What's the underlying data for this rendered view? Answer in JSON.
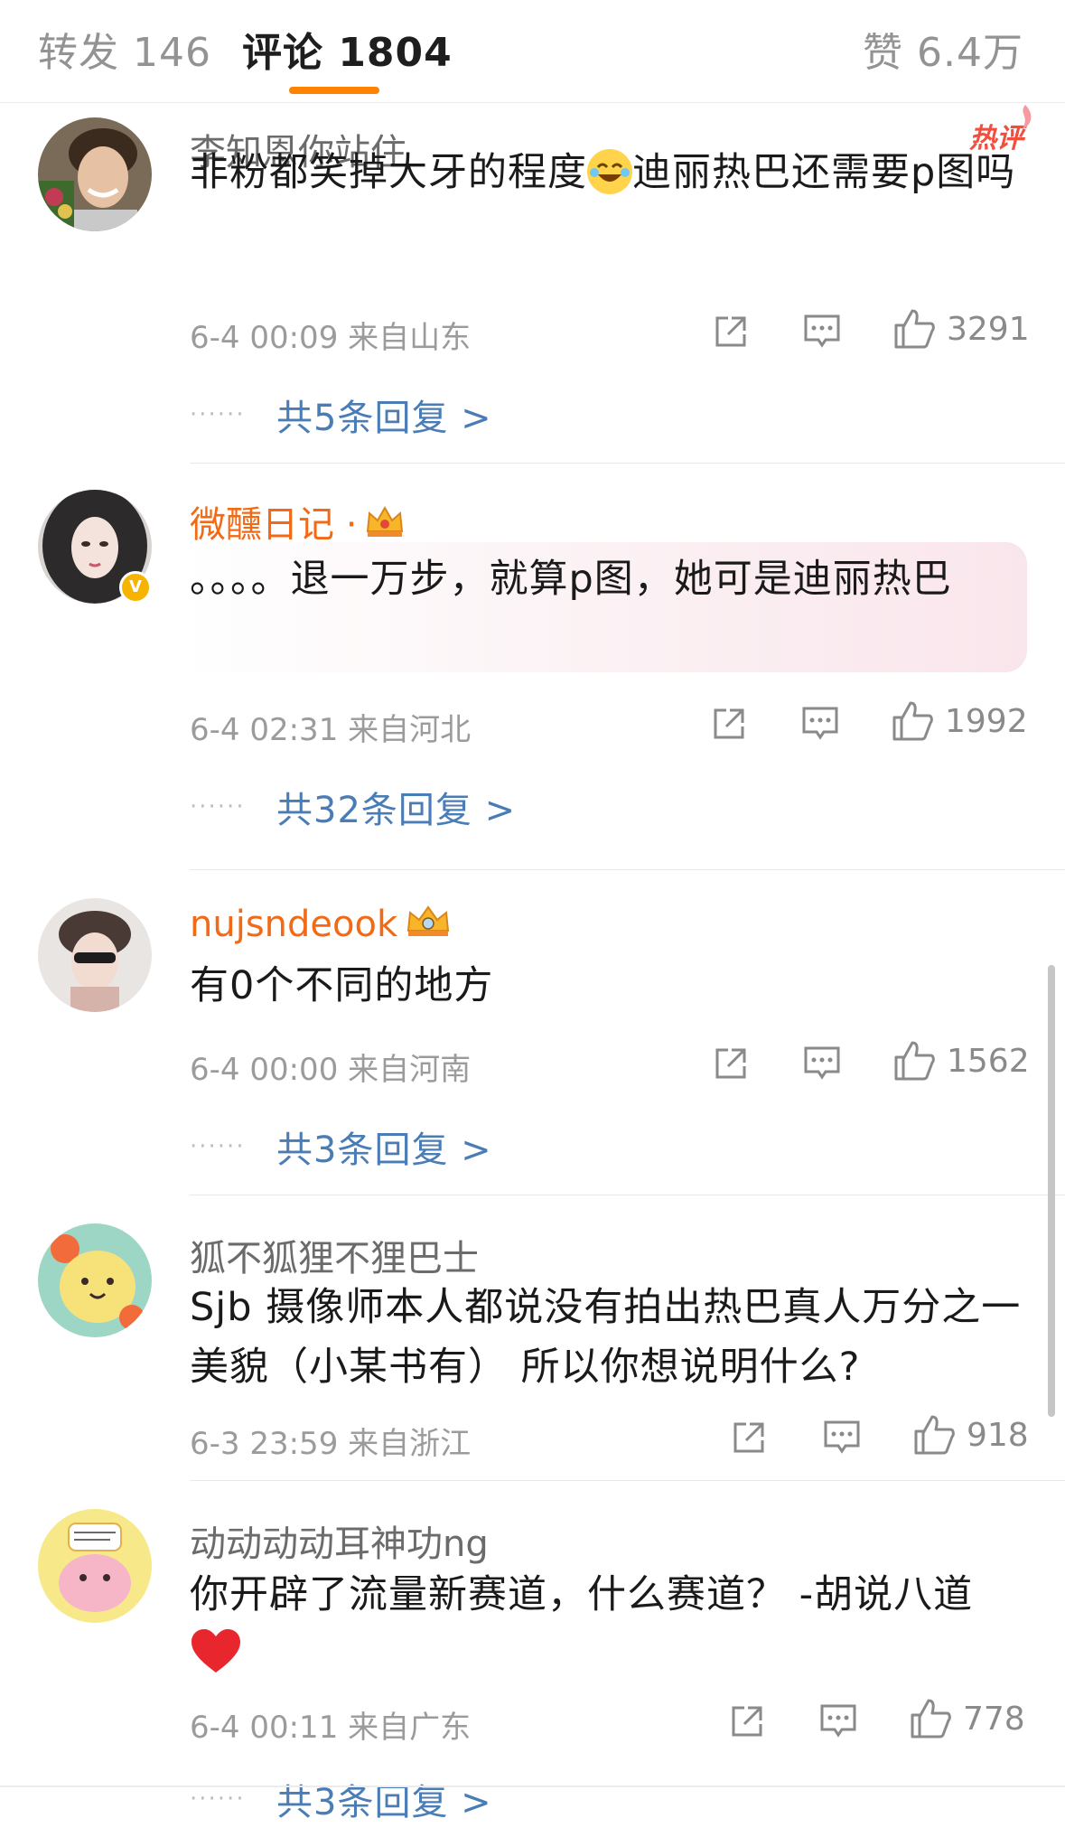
{
  "tabs": {
    "repost": "转发 146",
    "comment": "评论 1804",
    "like": "赞 6.4万"
  },
  "comments": [
    {
      "username": "李知恩你站住",
      "hot_badge": "热评",
      "text_1": "非粉都笑掉大牙的程度",
      "text_2": "迪丽热巴还需要p图吗",
      "time": "6-4 00:09 来自山东",
      "likes": "3291",
      "replies": "共5条回复 >"
    },
    {
      "username": "微醺日记 ·",
      "text": "。。。。退一万步，就算p图，她可是迪丽热巴",
      "time": "6-4 02:31 来自河北",
      "likes": "1992",
      "replies": "共32条回复 >"
    },
    {
      "username": "nujsndeook",
      "text": "有0个不同的地方",
      "time": "6-4 00:00 来自河南",
      "likes": "1562",
      "replies": "共3条回复 >"
    },
    {
      "username": "狐不狐狸不狸巴士",
      "text": "Sjb 摄像师本人都说没有拍出热巴真人万分之一美貌（小某书有） 所以你想说明什么?",
      "time": "6-3 23:59 来自浙江",
      "likes": "918"
    },
    {
      "username": "动动动动耳神功ng",
      "text": "你开辟了流量新赛道，什么赛道？ -胡说八道",
      "time": "6-4 00:11 来自广东",
      "likes": "778",
      "replies": "共3条回复 >"
    }
  ],
  "icons": [
    "share-icon",
    "reply-icon",
    "like-icon",
    "crown-icon",
    "heart-emoji",
    "laugh-emoji",
    "verified-icon"
  ],
  "colors": {
    "accent": "#ff8200",
    "vip_name": "#f26a16",
    "link": "#4a7cb5",
    "hot": "#f24d3d"
  }
}
